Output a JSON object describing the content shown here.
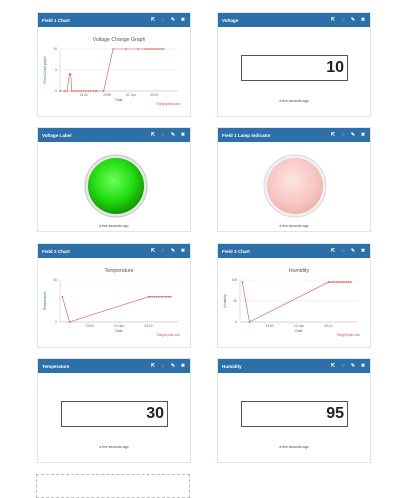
{
  "icons": {
    "popout": "⇱",
    "comment": "◌",
    "edit": "✎",
    "close": "✖"
  },
  "colors": {
    "header": "#2d70a8",
    "line": "#d9534f",
    "lamp_on": "#22cc22",
    "lamp_off": "#f5c9c6"
  },
  "cards": {
    "field1_chart": {
      "title": "Field 1 Chart",
      "credit": "ThingSpeak.com"
    },
    "voltage": {
      "title": "Voltage",
      "value": "10",
      "ago": "a few seconds ago"
    },
    "voltage_label": {
      "title": "Voltage Label",
      "ago": "a few seconds ago",
      "lamp_state": "on"
    },
    "field1_lamp": {
      "title": "Field 1 Lamp Indicator",
      "ago": "a few seconds ago",
      "lamp_state": "off"
    },
    "field2_chart": {
      "title": "Field 2 Chart",
      "credit": "ThingSpeak.com"
    },
    "field3_chart": {
      "title": "Field 3 Chart",
      "credit": "ThingSpeak.com"
    },
    "temperature": {
      "title": "Temperature",
      "value": "30",
      "ago": "a few seconds ago"
    },
    "humidity": {
      "title": "Humidity",
      "value": "95",
      "ago": "a few seconds ago"
    }
  },
  "chart_data": [
    {
      "type": "line",
      "title": "Voltage Change Graph",
      "xlabel": "Date",
      "ylabel": "Fluxa Chart graph",
      "x_ticks": [
        "23:40",
        "23:50",
        "10. Apr",
        "00:10"
      ],
      "y_ticks": [
        "10",
        "5",
        "0"
      ],
      "ylim": [
        0,
        10
      ],
      "xlim": [
        0,
        100
      ],
      "series": [
        {
          "x": [
            0,
            4,
            6,
            8,
            9,
            10,
            12,
            14,
            16,
            18,
            20,
            22,
            24,
            26,
            28,
            30,
            31,
            37,
            45,
            56,
            66,
            72,
            74,
            76,
            78,
            80,
            82,
            84,
            86,
            88
          ],
          "y": [
            0,
            0,
            0,
            4,
            4,
            0,
            0,
            0,
            0,
            0,
            0,
            0,
            0,
            0,
            0,
            0,
            0,
            0,
            10,
            10,
            10,
            10,
            10,
            10,
            10,
            10,
            10,
            10,
            10,
            10
          ]
        }
      ]
    },
    {
      "type": "line",
      "title": "Temperature",
      "xlabel": "Date",
      "ylabel": "Temperature",
      "x_ticks": [
        "23:50",
        "10. Apr",
        "00:10"
      ],
      "y_ticks": [
        "50",
        "0"
      ],
      "ylim": [
        0,
        50
      ],
      "xlim": [
        0,
        100
      ],
      "series": [
        {
          "x": [
            2,
            8,
            75,
            76,
            78,
            80,
            82,
            84,
            86,
            88,
            90,
            92,
            94
          ],
          "y": [
            30,
            0,
            30,
            30,
            30,
            30,
            30,
            30,
            30,
            30,
            30,
            30,
            30
          ]
        }
      ]
    },
    {
      "type": "line",
      "title": "Humidity",
      "xlabel": "Date",
      "ylabel": "Humidity",
      "x_ticks": [
        "23:50",
        "10. Apr",
        "00:10"
      ],
      "y_ticks": [
        "100",
        "50",
        "0"
      ],
      "ylim": [
        0,
        100
      ],
      "xlim": [
        0,
        100
      ],
      "series": [
        {
          "x": [
            2,
            8,
            75,
            76,
            78,
            80,
            82,
            84,
            86,
            88,
            90,
            92,
            94
          ],
          "y": [
            95,
            0,
            95,
            95,
            95,
            95,
            95,
            95,
            95,
            95,
            95,
            95,
            95
          ]
        }
      ]
    }
  ]
}
